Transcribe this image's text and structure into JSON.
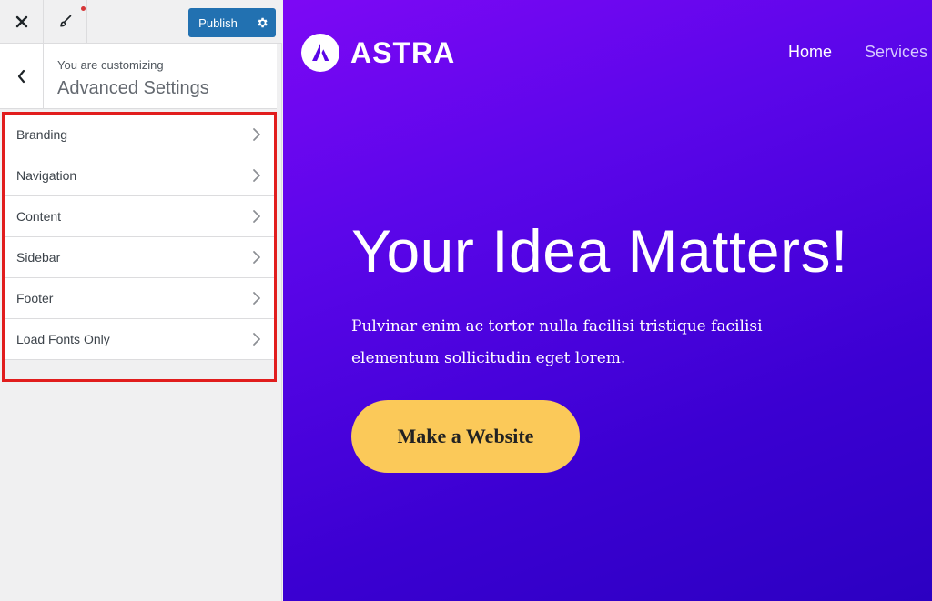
{
  "colors": {
    "publish_blue": "#2271b1",
    "notification_red": "#d63638",
    "highlight_red": "#e11d1d",
    "hero_gradient_start": "#7d08f5",
    "hero_gradient_end": "#2c00c2",
    "cta_yellow": "#fbc959"
  },
  "topbar": {
    "close_icon": "close-icon",
    "brush_icon": "paintbrush-icon",
    "publish_label": "Publish",
    "settings_icon": "gear-icon"
  },
  "section": {
    "customizing_label": "You are customizing",
    "title": "Advanced Settings",
    "back_icon": "chevron-left-icon"
  },
  "panels": [
    {
      "label": "Branding"
    },
    {
      "label": "Navigation"
    },
    {
      "label": "Content"
    },
    {
      "label": "Sidebar"
    },
    {
      "label": "Footer"
    },
    {
      "label": "Load Fonts Only"
    }
  ],
  "preview": {
    "logo_text": "ASTRA",
    "nav": [
      {
        "label": "Home"
      },
      {
        "label": "Services"
      }
    ],
    "hero_title": "Your Idea Matters!",
    "hero_text_line1": "Pulvinar enim ac tortor nulla facilisi tristique facilisi",
    "hero_text_line2": "elementum sollicitudin eget lorem.",
    "cta_label": "Make a Website"
  }
}
